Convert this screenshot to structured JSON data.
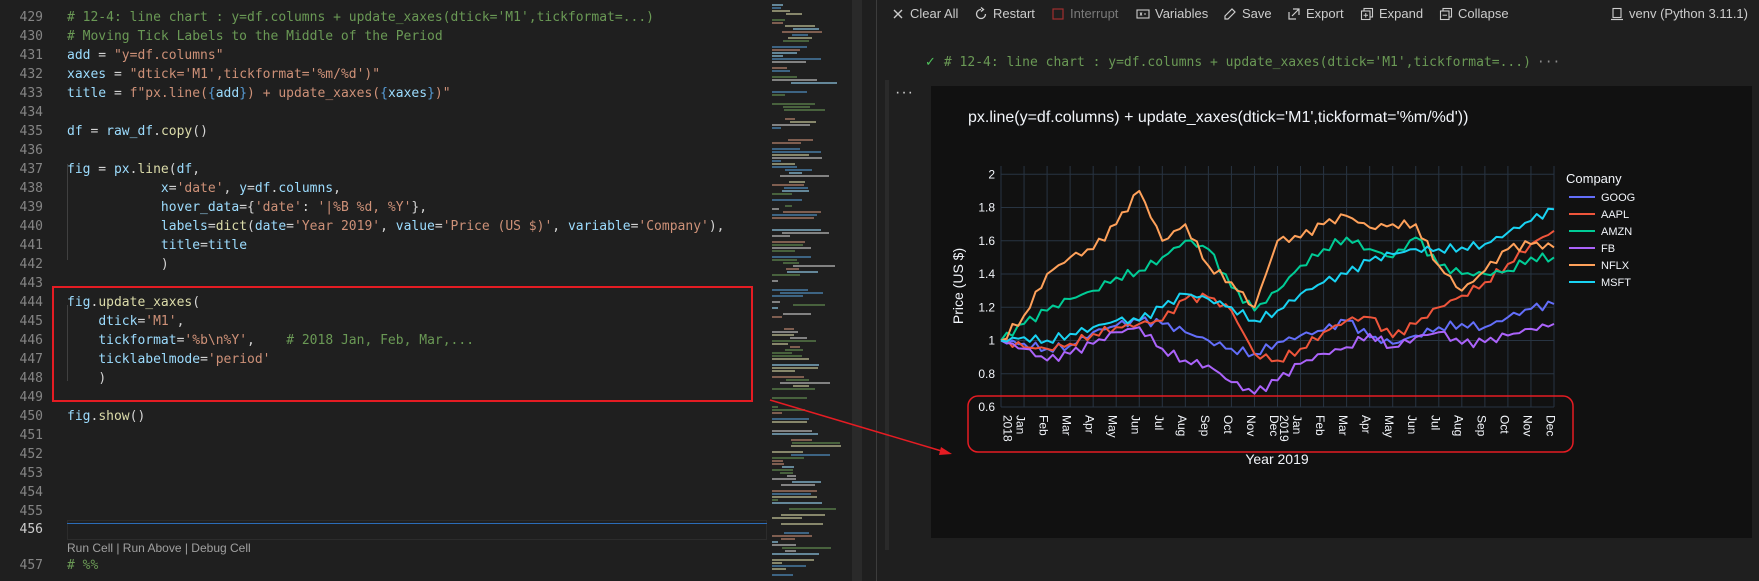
{
  "editor": {
    "lines": [
      {
        "n": "429",
        "tokens": [
          {
            "t": "# 12-4: line chart : y=df.columns + update_xaxes(dtick='M1',tickformat=...)",
            "c": "comment"
          }
        ]
      },
      {
        "n": "430",
        "tokens": [
          {
            "t": "# Moving Tick Labels to the Middle of the Period",
            "c": "comment"
          }
        ]
      },
      {
        "n": "431",
        "tokens": [
          {
            "t": "add",
            "c": "var"
          },
          {
            "t": " = ",
            "c": "plain"
          },
          {
            "t": "\"y=df.columns\"",
            "c": "string"
          }
        ]
      },
      {
        "n": "432",
        "tokens": [
          {
            "t": "xaxes",
            "c": "var"
          },
          {
            "t": " = ",
            "c": "plain"
          },
          {
            "t": "\"dtick='M1',tickformat='%m/%d')\"",
            "c": "string"
          }
        ]
      },
      {
        "n": "433",
        "tokens": [
          {
            "t": "title",
            "c": "var"
          },
          {
            "t": " = ",
            "c": "plain"
          },
          {
            "t": "f\"px.line(",
            "c": "string"
          },
          {
            "t": "{",
            "c": "brace"
          },
          {
            "t": "add",
            "c": "var"
          },
          {
            "t": "}",
            "c": "brace"
          },
          {
            "t": ") + update_xaxes(",
            "c": "string"
          },
          {
            "t": "{",
            "c": "brace"
          },
          {
            "t": "xaxes",
            "c": "var"
          },
          {
            "t": "}",
            "c": "brace"
          },
          {
            "t": ")\"",
            "c": "string"
          }
        ]
      },
      {
        "n": "434",
        "tokens": []
      },
      {
        "n": "435",
        "tokens": [
          {
            "t": "df",
            "c": "var"
          },
          {
            "t": " = ",
            "c": "plain"
          },
          {
            "t": "raw_df",
            "c": "var"
          },
          {
            "t": ".",
            "c": "plain"
          },
          {
            "t": "copy",
            "c": "func"
          },
          {
            "t": "()",
            "c": "plain"
          }
        ]
      },
      {
        "n": "436",
        "tokens": []
      },
      {
        "n": "437",
        "tokens": [
          {
            "t": "fig",
            "c": "var"
          },
          {
            "t": " = ",
            "c": "plain"
          },
          {
            "t": "px",
            "c": "var"
          },
          {
            "t": ".",
            "c": "plain"
          },
          {
            "t": "line",
            "c": "func"
          },
          {
            "t": "(",
            "c": "plain"
          },
          {
            "t": "df",
            "c": "var"
          },
          {
            "t": ",",
            "c": "plain"
          }
        ]
      },
      {
        "n": "438",
        "tokens": [
          {
            "t": "            ",
            "c": "plain"
          },
          {
            "t": "x",
            "c": "var"
          },
          {
            "t": "=",
            "c": "plain"
          },
          {
            "t": "'date'",
            "c": "string"
          },
          {
            "t": ", ",
            "c": "plain"
          },
          {
            "t": "y",
            "c": "var"
          },
          {
            "t": "=",
            "c": "plain"
          },
          {
            "t": "df",
            "c": "var"
          },
          {
            "t": ".",
            "c": "plain"
          },
          {
            "t": "columns",
            "c": "var"
          },
          {
            "t": ",",
            "c": "plain"
          }
        ]
      },
      {
        "n": "439",
        "tokens": [
          {
            "t": "            ",
            "c": "plain"
          },
          {
            "t": "hover_data",
            "c": "var"
          },
          {
            "t": "=",
            "c": "plain"
          },
          {
            "t": "{",
            "c": "plain"
          },
          {
            "t": "'date'",
            "c": "string"
          },
          {
            "t": ": ",
            "c": "plain"
          },
          {
            "t": "'|%B %d, %Y'",
            "c": "string"
          },
          {
            "t": "},",
            "c": "plain"
          }
        ]
      },
      {
        "n": "440",
        "tokens": [
          {
            "t": "            ",
            "c": "plain"
          },
          {
            "t": "labels",
            "c": "var"
          },
          {
            "t": "=",
            "c": "plain"
          },
          {
            "t": "dict",
            "c": "func"
          },
          {
            "t": "(",
            "c": "plain"
          },
          {
            "t": "date",
            "c": "var"
          },
          {
            "t": "=",
            "c": "plain"
          },
          {
            "t": "'Year 2019'",
            "c": "string"
          },
          {
            "t": ", ",
            "c": "plain"
          },
          {
            "t": "value",
            "c": "var"
          },
          {
            "t": "=",
            "c": "plain"
          },
          {
            "t": "'Price (US $)'",
            "c": "string"
          },
          {
            "t": ", ",
            "c": "plain"
          },
          {
            "t": "variable",
            "c": "var"
          },
          {
            "t": "=",
            "c": "plain"
          },
          {
            "t": "'Company'",
            "c": "string"
          },
          {
            "t": "),",
            "c": "plain"
          }
        ]
      },
      {
        "n": "441",
        "tokens": [
          {
            "t": "            ",
            "c": "plain"
          },
          {
            "t": "title",
            "c": "var"
          },
          {
            "t": "=",
            "c": "plain"
          },
          {
            "t": "title",
            "c": "var"
          }
        ]
      },
      {
        "n": "442",
        "tokens": [
          {
            "t": "            ",
            "c": "plain"
          },
          {
            "t": ")",
            "c": "plain"
          }
        ]
      },
      {
        "n": "443",
        "tokens": []
      },
      {
        "n": "444",
        "tokens": [
          {
            "t": "fig",
            "c": "var"
          },
          {
            "t": ".",
            "c": "plain"
          },
          {
            "t": "update_xaxes",
            "c": "func"
          },
          {
            "t": "(",
            "c": "plain"
          }
        ]
      },
      {
        "n": "445",
        "tokens": [
          {
            "t": "    ",
            "c": "plain"
          },
          {
            "t": "dtick",
            "c": "var"
          },
          {
            "t": "=",
            "c": "plain"
          },
          {
            "t": "'M1'",
            "c": "string"
          },
          {
            "t": ",",
            "c": "plain"
          }
        ]
      },
      {
        "n": "446",
        "tokens": [
          {
            "t": "    ",
            "c": "plain"
          },
          {
            "t": "tickformat",
            "c": "var"
          },
          {
            "t": "=",
            "c": "plain"
          },
          {
            "t": "'%b\\n%Y'",
            "c": "string"
          },
          {
            "t": ",    ",
            "c": "plain"
          },
          {
            "t": "# 2018 Jan, Feb, Mar,...",
            "c": "comment"
          }
        ]
      },
      {
        "n": "447",
        "tokens": [
          {
            "t": "    ",
            "c": "plain"
          },
          {
            "t": "ticklabelmode",
            "c": "var"
          },
          {
            "t": "=",
            "c": "plain"
          },
          {
            "t": "'period'",
            "c": "string"
          }
        ]
      },
      {
        "n": "448",
        "tokens": [
          {
            "t": "    ",
            "c": "plain"
          },
          {
            "t": ")",
            "c": "plain"
          }
        ]
      },
      {
        "n": "449",
        "tokens": []
      },
      {
        "n": "450",
        "tokens": [
          {
            "t": "fig",
            "c": "var"
          },
          {
            "t": ".",
            "c": "plain"
          },
          {
            "t": "show",
            "c": "func"
          },
          {
            "t": "()",
            "c": "plain"
          }
        ]
      },
      {
        "n": "451",
        "tokens": []
      },
      {
        "n": "452",
        "tokens": []
      },
      {
        "n": "453",
        "tokens": []
      },
      {
        "n": "454",
        "tokens": []
      },
      {
        "n": "455",
        "tokens": []
      },
      {
        "n": "456",
        "tokens": []
      },
      {
        "n": "457",
        "tokens": [
          {
            "t": "# %%",
            "c": "comment"
          }
        ]
      }
    ],
    "codelens": "Run Cell | Run Above | Debug Cell"
  },
  "toolbar": {
    "clear_all": "Clear All",
    "restart": "Restart",
    "interrupt": "Interrupt",
    "variables": "Variables",
    "save": "Save",
    "export": "Export",
    "expand": "Expand",
    "collapse": "Collapse",
    "kernel": "venv (Python 3.11.1)"
  },
  "cell": {
    "header": "# 12-4: line chart : y=df.columns + update_xaxes(dtick='M1',tickformat=...)",
    "status_icon": "check-icon"
  },
  "chart_data": {
    "type": "line",
    "title": "px.line(y=df.columns) + update_xaxes(dtick='M1',tickformat='%m/%d'))",
    "xlabel": "Year 2019",
    "ylabel": "Price (US $)",
    "ylim": [
      0.6,
      2.05
    ],
    "yticks": [
      "0.6",
      "0.8",
      "1",
      "1.2",
      "1.4",
      "1.6",
      "1.8",
      "2"
    ],
    "xticks": [
      "Jan\n2018",
      "Feb",
      "Mar",
      "Apr",
      "May",
      "Jun",
      "Jul",
      "Aug",
      "Sep",
      "Oct",
      "Nov",
      "Dec",
      "Jan\n2019",
      "Feb",
      "Mar",
      "Apr",
      "May",
      "Jun",
      "Jul",
      "Aug",
      "Sep",
      "Oct",
      "Nov",
      "Dec"
    ],
    "legend_title": "Company",
    "legend_position": "right",
    "grid": true,
    "x": [
      0,
      1,
      2,
      3,
      4,
      5,
      6,
      7,
      8,
      9,
      10,
      11,
      12,
      13,
      14,
      15,
      16,
      17,
      18,
      19,
      20,
      21,
      22,
      23,
      24
    ],
    "series": [
      {
        "name": "GOOG",
        "color": "#636efa",
        "values": [
          1.0,
          0.98,
          0.95,
          0.97,
          1.05,
          1.09,
          1.12,
          1.1,
          1.05,
          1.0,
          0.95,
          0.92,
          0.99,
          1.03,
          1.06,
          1.12,
          1.02,
          0.98,
          1.03,
          1.08,
          1.1,
          1.08,
          1.14,
          1.19,
          1.22
        ]
      },
      {
        "name": "AAPL",
        "color": "#ef553b",
        "values": [
          1.0,
          0.96,
          0.95,
          0.98,
          1.04,
          1.08,
          1.1,
          1.12,
          1.25,
          1.26,
          1.18,
          0.92,
          0.88,
          0.95,
          1.05,
          1.12,
          1.14,
          1.02,
          1.1,
          1.2,
          1.27,
          1.35,
          1.46,
          1.58,
          1.66
        ]
      },
      {
        "name": "AMZN",
        "color": "#00cc96",
        "values": [
          1.0,
          1.1,
          1.18,
          1.25,
          1.3,
          1.38,
          1.42,
          1.5,
          1.6,
          1.55,
          1.32,
          1.18,
          1.3,
          1.45,
          1.55,
          1.62,
          1.55,
          1.5,
          1.62,
          1.45,
          1.4,
          1.4,
          1.42,
          1.5,
          1.5
        ]
      },
      {
        "name": "FB",
        "color": "#ab63fa",
        "values": [
          1.0,
          0.95,
          0.88,
          0.92,
          0.98,
          1.05,
          1.08,
          0.95,
          0.88,
          0.85,
          0.75,
          0.68,
          0.76,
          0.86,
          0.92,
          0.96,
          1.04,
          0.96,
          1.02,
          1.05,
          0.98,
          0.99,
          1.03,
          1.07,
          1.1
        ]
      },
      {
        "name": "NFLX",
        "color": "#ffa15a",
        "values": [
          1.0,
          1.15,
          1.4,
          1.5,
          1.55,
          1.7,
          1.9,
          1.6,
          1.7,
          1.45,
          1.35,
          1.2,
          1.6,
          1.62,
          1.7,
          1.75,
          1.68,
          1.7,
          1.7,
          1.45,
          1.3,
          1.42,
          1.55,
          1.58,
          1.56
        ]
      },
      {
        "name": "MSFT",
        "color": "#19d3f3",
        "values": [
          1.0,
          1.02,
          1.0,
          1.04,
          1.08,
          1.12,
          1.12,
          1.2,
          1.28,
          1.25,
          1.2,
          1.12,
          1.18,
          1.28,
          1.35,
          1.4,
          1.48,
          1.52,
          1.55,
          1.55,
          1.56,
          1.58,
          1.65,
          1.72,
          1.79
        ]
      }
    ]
  }
}
